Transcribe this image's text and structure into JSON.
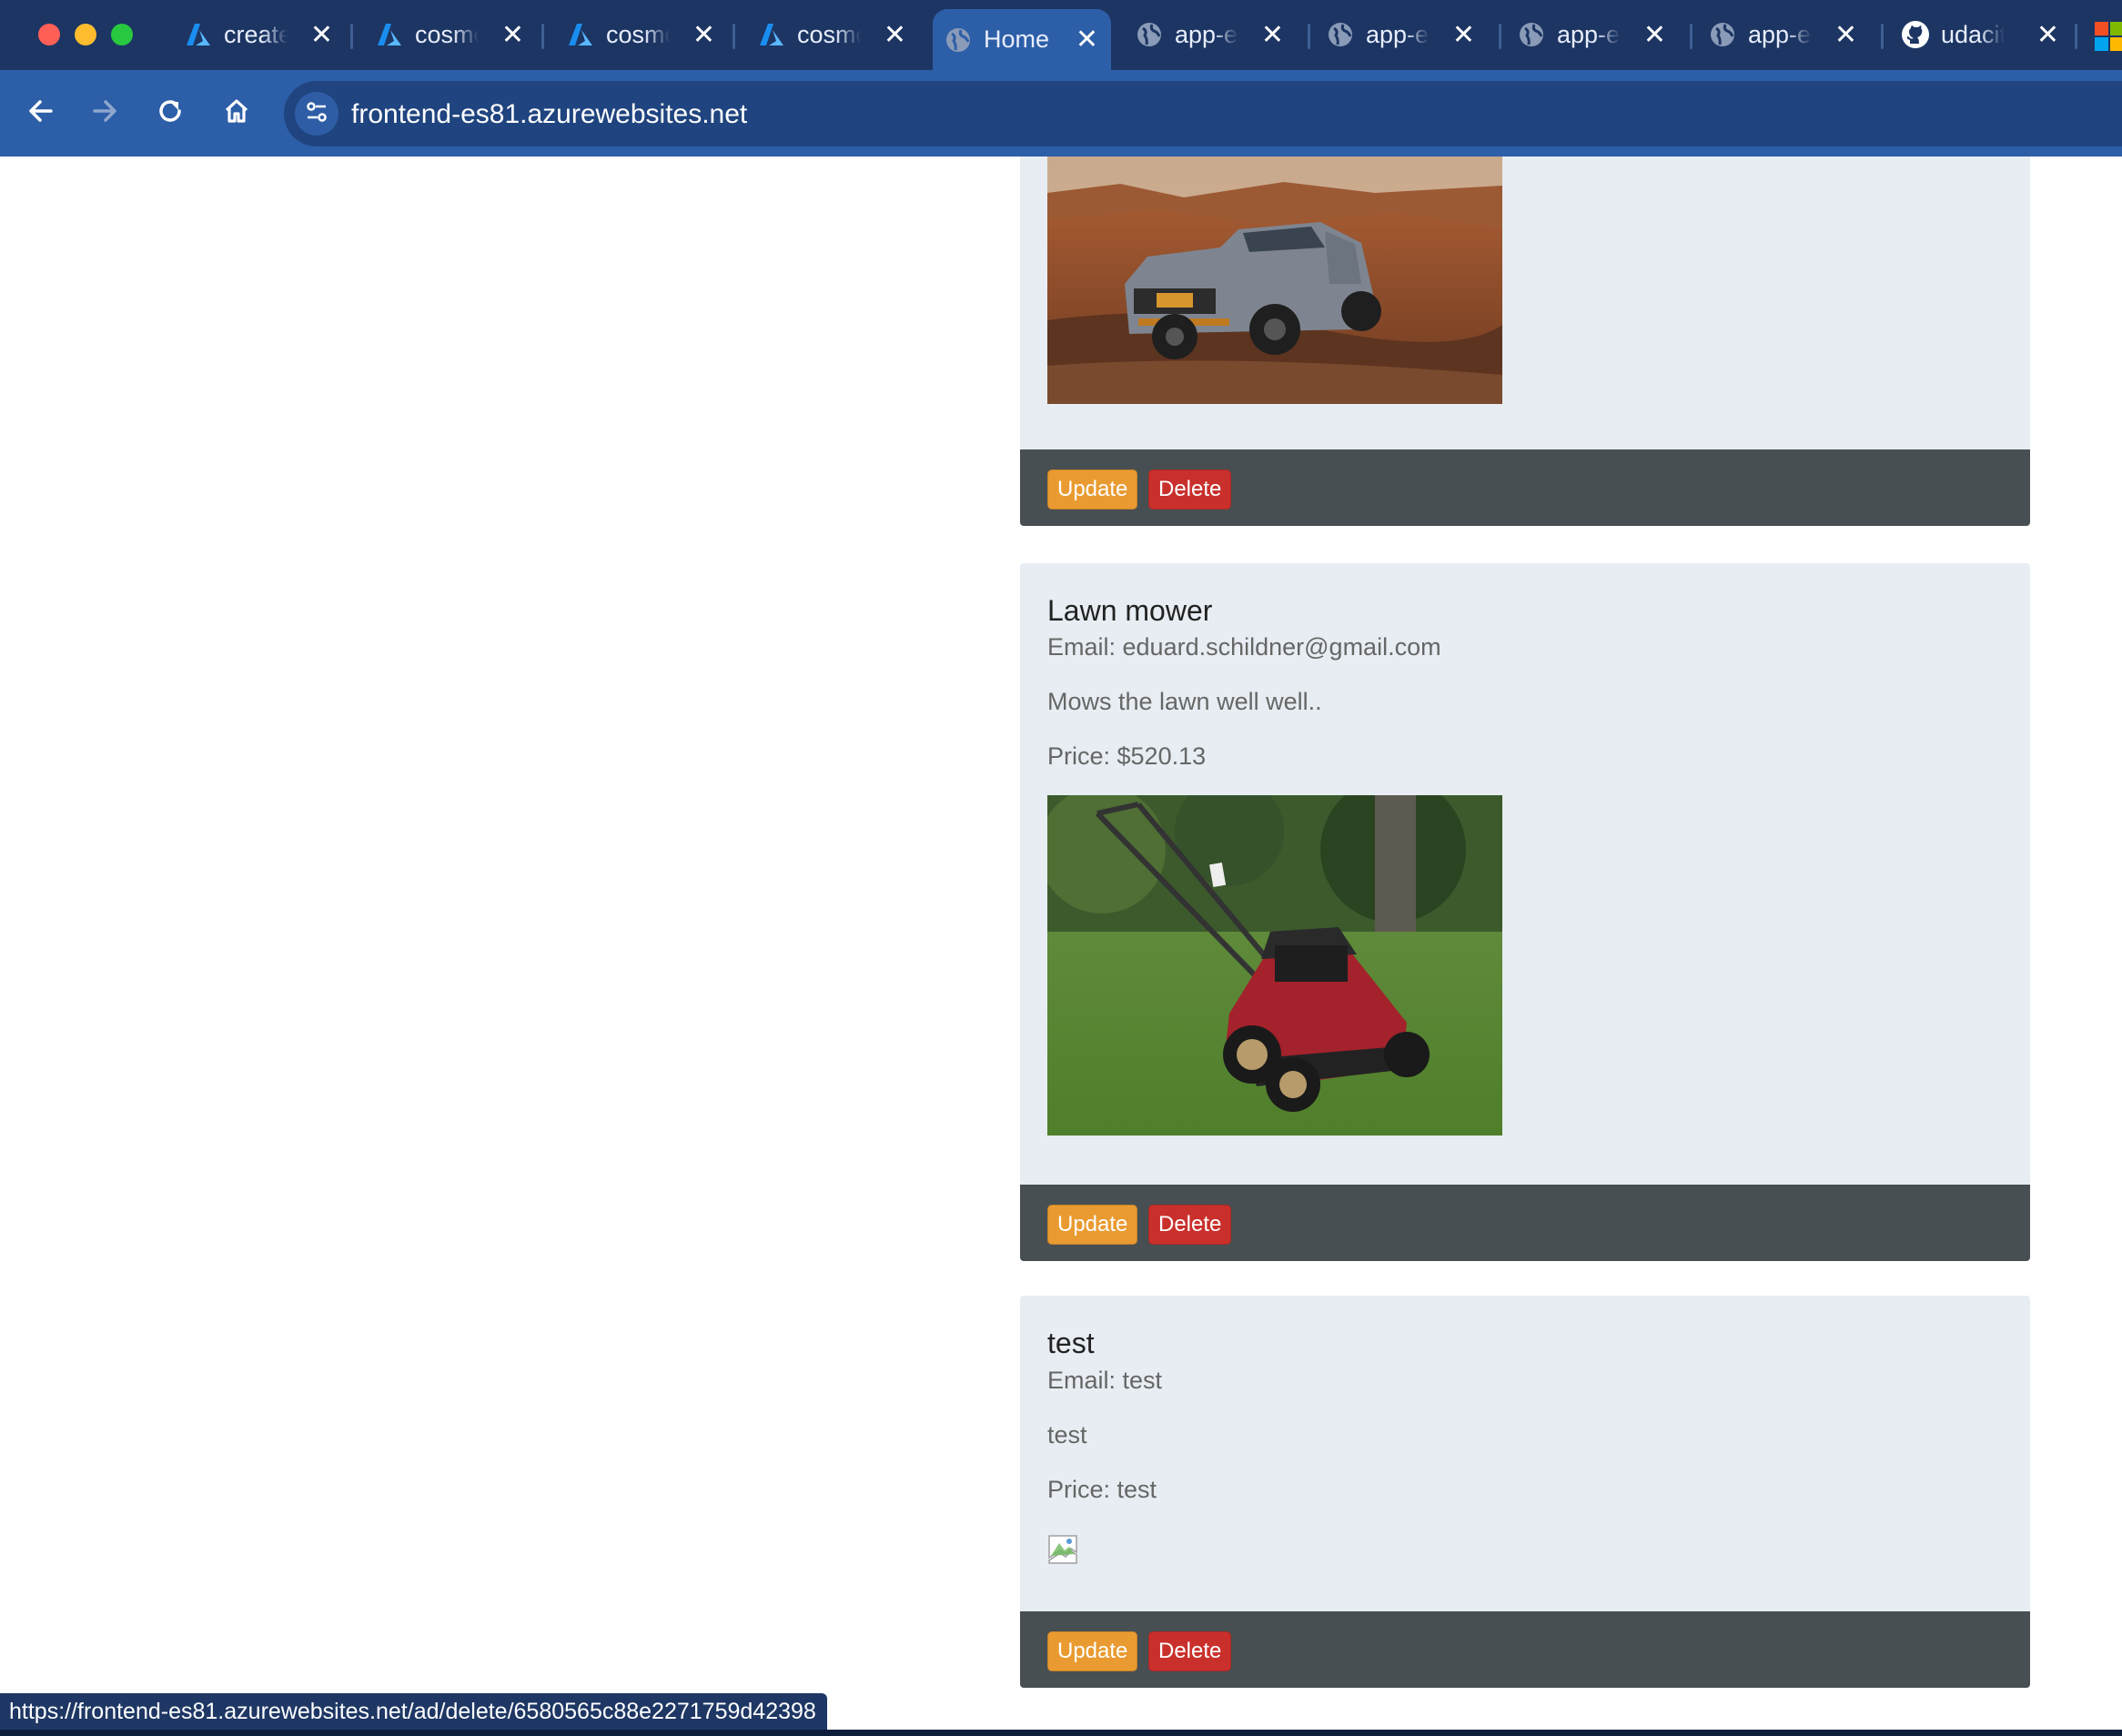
{
  "browser": {
    "tabs": [
      {
        "label": "create",
        "icon": "azure-icon",
        "active": false
      },
      {
        "label": "cosmos",
        "icon": "azure-icon",
        "active": false
      },
      {
        "label": "cosmos",
        "icon": "azure-icon",
        "active": false
      },
      {
        "label": "cosmos",
        "icon": "azure-icon",
        "active": false
      },
      {
        "label": "Home",
        "icon": "globe-icon",
        "active": true
      },
      {
        "label": "app-e",
        "icon": "globe-icon",
        "active": false
      },
      {
        "label": "app-e",
        "icon": "globe-icon",
        "active": false
      },
      {
        "label": "app-e",
        "icon": "globe-icon",
        "active": false
      },
      {
        "label": "app-e",
        "icon": "globe-icon",
        "active": false
      },
      {
        "label": "udacity",
        "icon": "github-icon",
        "active": false
      }
    ],
    "close_glyph": "✕",
    "url": "frontend-es81.azurewebsites.net",
    "status_url": "https://frontend-es81.azurewebsites.net/ad/delete/6580565c88e2271759d42398"
  },
  "ads": [
    {
      "image": "pickup-truck-photo",
      "update_label": "Update",
      "delete_label": "Delete"
    },
    {
      "title": "Lawn mower",
      "email": "Email: eduard.schildner@gmail.com",
      "description": "Mows the lawn well well..",
      "price": "Price: $520.13",
      "image": "lawn-mower-photo",
      "update_label": "Update",
      "delete_label": "Delete"
    },
    {
      "title": "test",
      "email": "Email: test",
      "description": "test",
      "price": "Price: test",
      "image": "broken-image-icon",
      "update_label": "Update",
      "delete_label": "Delete"
    }
  ],
  "colors": {
    "tabbar": "#1c3563",
    "toolbar": "#2d5ea8",
    "card_bg": "#e7edf2",
    "card_footer": "#474f52",
    "update_btn": "#e99b31",
    "delete_btn": "#c9302c"
  }
}
